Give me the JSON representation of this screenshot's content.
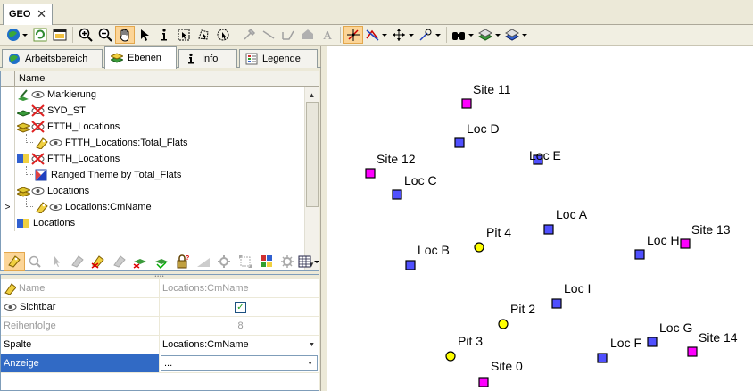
{
  "doc_tab": {
    "title": "GEO",
    "close": "✕"
  },
  "panel_tabs": [
    {
      "label": "Arbeitsbereich"
    },
    {
      "label": "Ebenen"
    },
    {
      "label": "Info"
    },
    {
      "label": "Legende"
    }
  ],
  "layers": {
    "header": "Name",
    "rows": [
      {
        "name": "Markierung"
      },
      {
        "name": "SYD_ST"
      },
      {
        "name": "FTTH_Locations"
      },
      {
        "name": "FTTH_Locations:Total_Flats"
      },
      {
        "name": "FTTH_Locations"
      },
      {
        "name": "Ranged Theme by Total_Flats"
      },
      {
        "name": "Locations"
      },
      {
        "name": "Locations:CmName",
        "marker": ">"
      },
      {
        "name": "Locations"
      }
    ]
  },
  "properties": {
    "rows": [
      {
        "key": "Name",
        "value": "Locations:CmName",
        "disabled": true
      },
      {
        "key": "Sichtbar",
        "value": "✓"
      },
      {
        "key": "Reihenfolge",
        "value": "8",
        "disabled": true
      },
      {
        "key": "Spalte",
        "value": "Locations:CmName"
      },
      {
        "key": "Anzeige",
        "value": "...",
        "selected": true
      }
    ]
  },
  "map": {
    "colors": {
      "site": "#ff00ff",
      "loc": "#5050ff",
      "pit": "#ffff00"
    },
    "features": [
      {
        "label": "Site 11",
        "type": "site"
      },
      {
        "label": "Loc D",
        "type": "loc"
      },
      {
        "label": "Loc E",
        "type": "loc"
      },
      {
        "label": "Site 12",
        "type": "site"
      },
      {
        "label": "Loc C",
        "type": "loc"
      },
      {
        "label": "Loc A",
        "type": "loc"
      },
      {
        "label": "Pit 4",
        "type": "pit"
      },
      {
        "label": "Loc B",
        "type": "loc"
      },
      {
        "label": "Loc H",
        "type": "loc"
      },
      {
        "label": "Site 13",
        "type": "site"
      },
      {
        "label": "Loc I",
        "type": "loc"
      },
      {
        "label": "Pit 2",
        "type": "pit"
      },
      {
        "label": "Loc G",
        "type": "loc"
      },
      {
        "label": "Pit 3",
        "type": "pit"
      },
      {
        "label": "Loc F",
        "type": "loc"
      },
      {
        "label": "Site 14",
        "type": "site"
      },
      {
        "label": "Site 0",
        "type": "site"
      }
    ]
  }
}
